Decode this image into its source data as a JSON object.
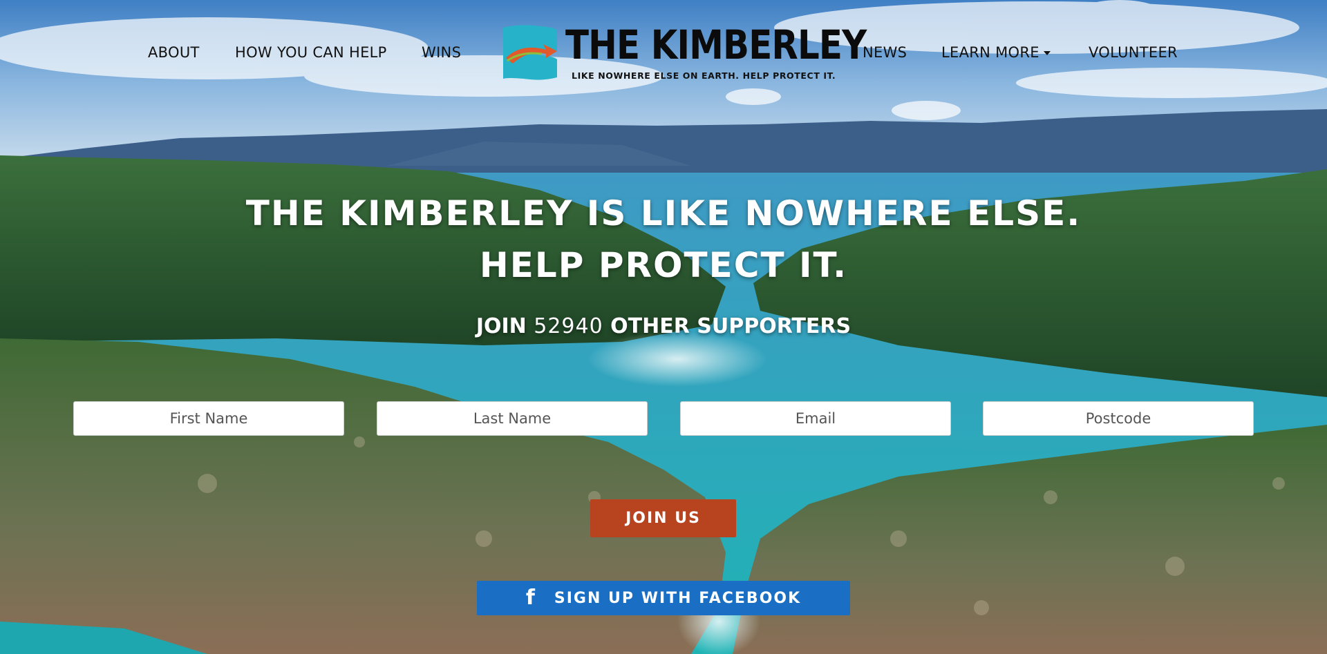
{
  "nav": {
    "left": [
      {
        "label": "ABOUT"
      },
      {
        "label": "HOW YOU CAN HELP"
      },
      {
        "label": "WINS"
      }
    ],
    "right": [
      {
        "label": "NEWS"
      },
      {
        "label": "LEARN MORE",
        "has_dropdown": true
      },
      {
        "label": "VOLUNTEER"
      }
    ]
  },
  "logo": {
    "title": "THE KIMBERLEY",
    "tagline": "LIKE NOWHERE ELSE ON EARTH. HELP PROTECT IT."
  },
  "hero": {
    "line1": "THE KIMBERLEY IS LIKE NOWHERE ELSE.",
    "line2": "HELP PROTECT IT.",
    "join_prefix": "JOIN",
    "supporter_count": "52940",
    "join_suffix": "OTHER SUPPORTERS"
  },
  "form": {
    "first_name_placeholder": "First Name",
    "last_name_placeholder": "Last Name",
    "email_placeholder": "Email",
    "postcode_placeholder": "Postcode",
    "submit_label": "JOIN US",
    "facebook_label": "SIGN UP WITH FACEBOOK",
    "facebook_icon": "facebook-icon"
  },
  "colors": {
    "join_button": "#b8431f",
    "facebook_button": "#1a6fc4",
    "logo_teal": "#26b3c9",
    "logo_orange": "#e05a2b"
  }
}
